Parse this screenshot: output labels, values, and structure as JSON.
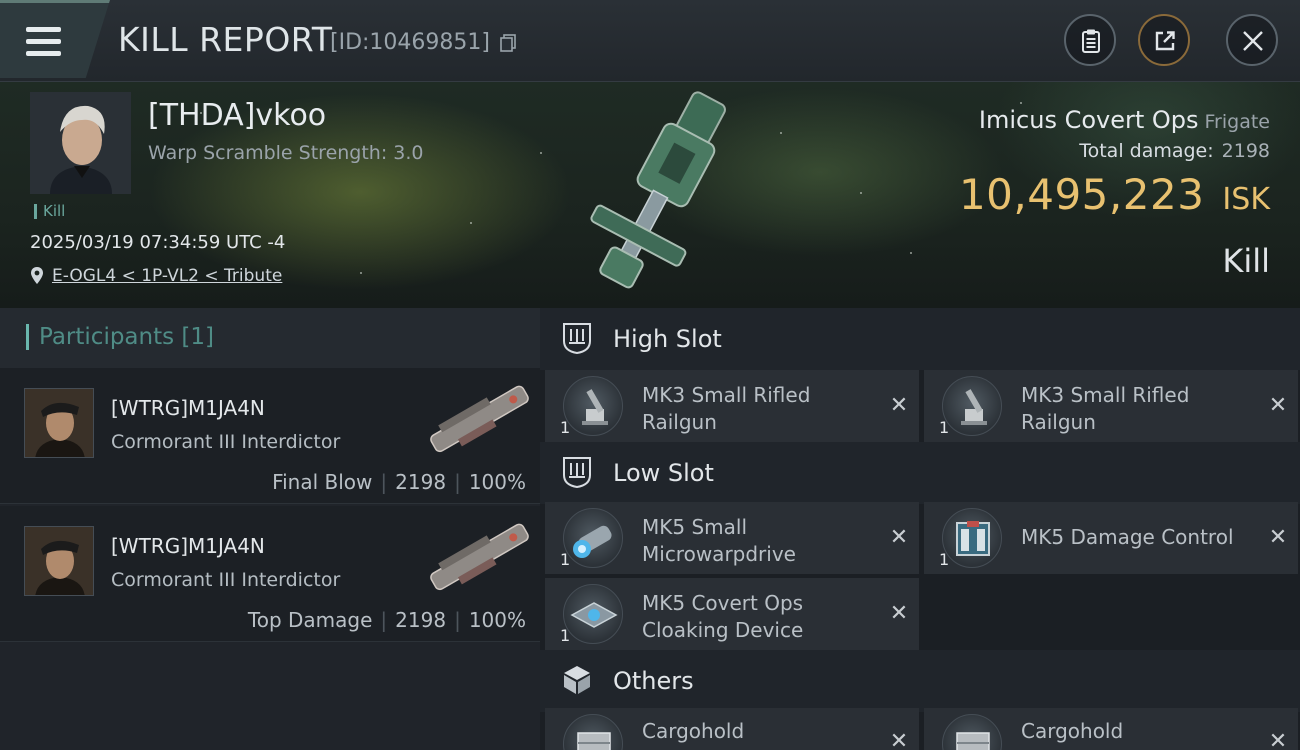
{
  "header": {
    "title": "KILL REPORT",
    "id_text": "[ID:10469851]"
  },
  "victim": {
    "name": "[THDA]vkoo",
    "warp_scramble": "Warp Scramble Strength: 3.0",
    "kill_tag": "Kill",
    "datetime": "2025/03/19 07:34:59 UTC -4",
    "location": "E-OGL4 < 1P-VL2 < Tribute",
    "ship_name": "Imicus Covert Ops",
    "ship_class": "Frigate",
    "total_damage_label": "Total damage:",
    "total_damage": "2198",
    "isk_value": "10,495,223",
    "isk_unit": "ISK",
    "result": "Kill"
  },
  "participants": {
    "title": "Participants [1]",
    "rows": [
      {
        "name": "[WTRG]M1JA4N",
        "ship": "Cormorant III Interdictor",
        "label": "Final Blow",
        "damage": "2198",
        "percent": "100%"
      },
      {
        "name": "[WTRG]M1JA4N",
        "ship": "Cormorant III Interdictor",
        "label": "Top Damage",
        "damage": "2198",
        "percent": "100%"
      }
    ]
  },
  "fitting": {
    "high_slot": {
      "label": "High Slot",
      "modules": [
        {
          "name": "MK3 Small Rifled Railgun",
          "qty": "1"
        },
        {
          "name": "MK3 Small Rifled Railgun",
          "qty": "1"
        }
      ]
    },
    "low_slot": {
      "label": "Low Slot",
      "modules": [
        {
          "name": "MK5 Small Microwarpdrive",
          "qty": "1"
        },
        {
          "name": "MK5 Damage Control",
          "qty": "1"
        },
        {
          "name": "MK5 Covert Ops Cloaking Device",
          "qty": "1"
        }
      ]
    },
    "others": {
      "label": "Others",
      "modules": [
        {
          "name": "Cargohold"
        },
        {
          "name": "Cargohold"
        }
      ]
    }
  },
  "colors": {
    "isk_gold": "#e8c170",
    "accent_teal": "#6ab7ae"
  }
}
